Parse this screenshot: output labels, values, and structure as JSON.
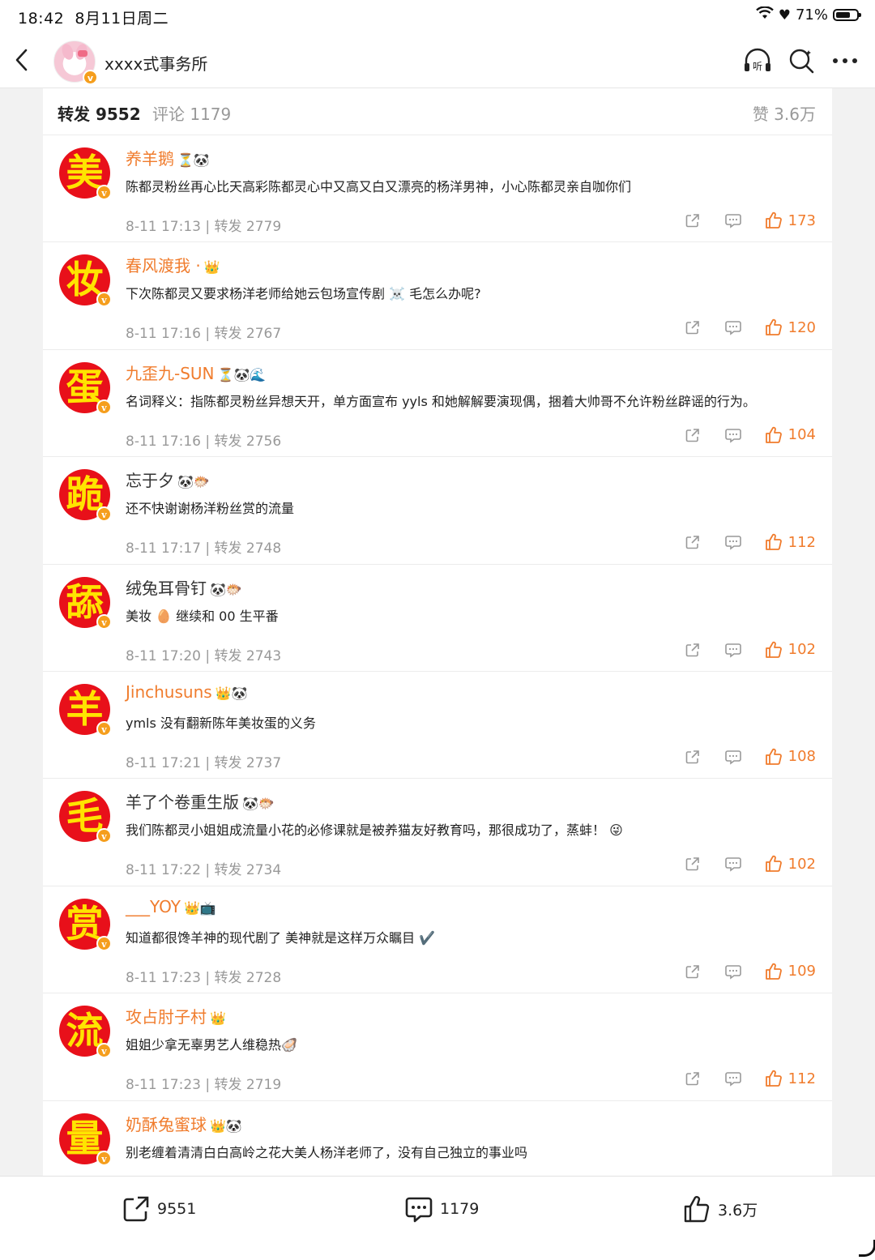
{
  "status_bar": {
    "time": "18:42",
    "date": "8月11日周二",
    "battery": "71%",
    "battery_level": 0.71
  },
  "header": {
    "account_name": "xxxx式事务所",
    "listen_label": "听"
  },
  "tabs": {
    "repost": "转发 9552",
    "comments": "评论 1179",
    "likes": "赞 3.6万"
  },
  "comments": [
    {
      "avatar_char": "美",
      "name": "养羊鹅",
      "name_color": "orange",
      "badges": "⏳🐼",
      "text": "陈都灵粉丝再心比天高彩陈都灵心中又高又白又漂亮的杨洋男神，小心陈都灵亲自咖你们",
      "meta": "8-11 17:13 | 转发 2779",
      "likes": "173"
    },
    {
      "avatar_char": "妆",
      "name": "春风渡我 ·",
      "name_color": "orange",
      "badges": "👑",
      "text": "下次陈都灵又要求杨洋老师给她云包场宣传剧 ☠️ 毛怎么办呢?",
      "meta": "8-11 17:16 | 转发 2767",
      "likes": "120"
    },
    {
      "avatar_char": "蛋",
      "name": "九歪九-SUN",
      "name_color": "orange",
      "badges": "⏳🐼🌊",
      "text": "名词释义：指陈都灵粉丝异想天开，单方面宣布 yyls 和她解解要演现偶，捆着大帅哥不允许粉丝辟谣的行为。",
      "meta": "8-11 17:16 | 转发 2756",
      "likes": "104"
    },
    {
      "avatar_char": "跪",
      "name": "忘于夕",
      "name_color": "gray",
      "badges": "🐼🐡",
      "text": "还不快谢谢杨洋粉丝赏的流量",
      "meta": "8-11 17:17 | 转发 2748",
      "likes": "112"
    },
    {
      "avatar_char": "舔",
      "name": "绒兔耳骨钉",
      "name_color": "gray",
      "badges": "🐼🐡",
      "text": "美妆 🥚 继续和 00 生平番",
      "meta": "8-11 17:20 | 转发 2743",
      "likes": "102"
    },
    {
      "avatar_char": "羊",
      "name": "Jinchusuns",
      "name_color": "orange",
      "badges": "👑🐼",
      "text": "ymls 没有翻新陈年美妆蛋的义务",
      "meta": "8-11 17:21 | 转发 2737",
      "likes": "108"
    },
    {
      "avatar_char": "毛",
      "name": "羊了个卷重生版",
      "name_color": "gray",
      "badges": "🐼🐡",
      "text": "我们陈都灵小姐姐成流量小花的必修课就是被养猫友好教育吗，那很成功了，蒸蚌！ 😜",
      "meta": "8-11 17:22 | 转发 2734",
      "likes": "102"
    },
    {
      "avatar_char": "赏",
      "name": "___YOY",
      "name_color": "orange",
      "badges": "👑📺",
      "text": "知道都很馋羊神的现代剧了 美神就是这样万众瞩目 ✔️",
      "meta": "8-11 17:23 | 转发 2728",
      "likes": "109"
    },
    {
      "avatar_char": "流",
      "name": "攻占肘子村",
      "name_color": "orange",
      "badges": "👑",
      "text": "姐姐少拿无辜男艺人维稳热🦪",
      "meta": "8-11 17:23 | 转发 2719",
      "likes": "112"
    },
    {
      "avatar_char": "量",
      "name": "奶酥兔蜜球",
      "name_color": "orange",
      "badges": "👑🐼",
      "text": "别老缠着清清白白高岭之花大美人杨洋老师了，没有自己独立的事业吗",
      "meta": "",
      "likes": ""
    }
  ],
  "bottom_bar": {
    "reposts": "9551",
    "comments": "1179",
    "likes": "3.6万"
  },
  "colors": {
    "accent": "#f07c2d",
    "avatar_bg": "#e8101a",
    "avatar_fg": "#ffe400",
    "verify": "#f59e1d"
  }
}
